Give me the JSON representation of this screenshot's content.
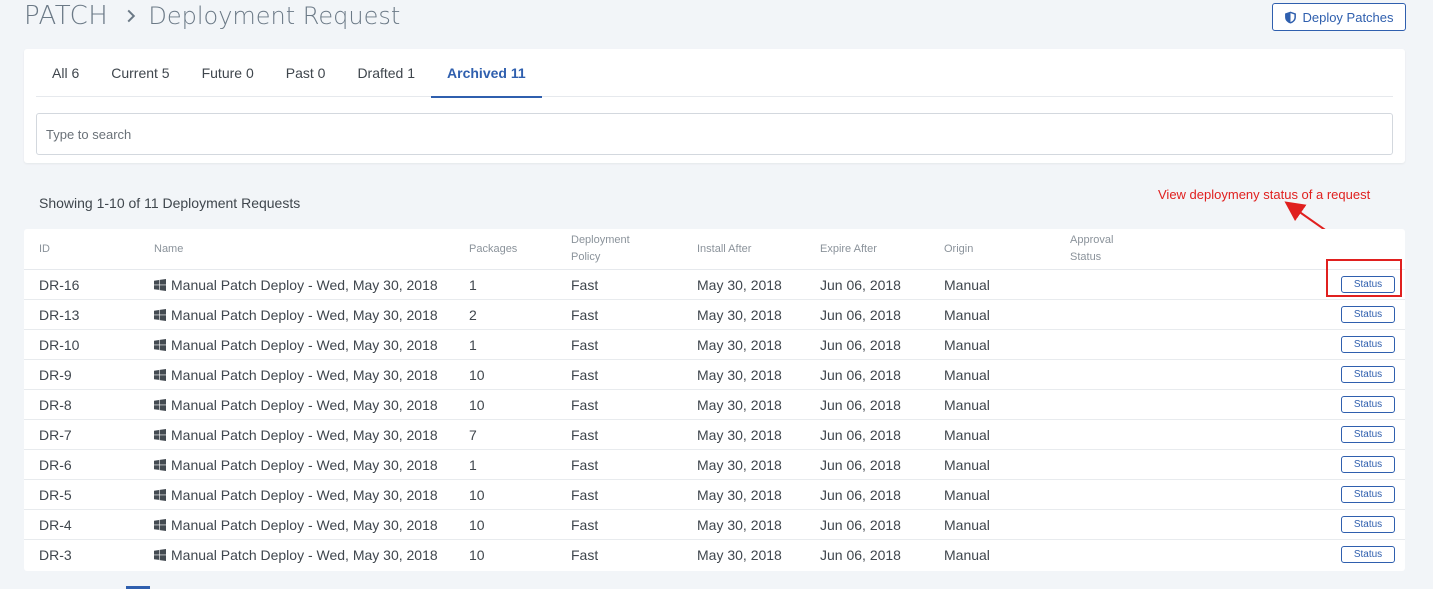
{
  "header": {
    "brand": "PATCH",
    "title": "Deployment Request",
    "deploy_button": "Deploy Patches"
  },
  "tabs": [
    {
      "label": "All 6",
      "active": false
    },
    {
      "label": "Current 5",
      "active": false
    },
    {
      "label": "Future 0",
      "active": false
    },
    {
      "label": "Past 0",
      "active": false
    },
    {
      "label": "Drafted 1",
      "active": false
    },
    {
      "label": "Archived 11",
      "active": true
    }
  ],
  "search": {
    "placeholder": "Type to search",
    "value": ""
  },
  "summary": "Showing 1-10 of 11 Deployment Requests",
  "annotation": "View deploymeny status of a request",
  "table": {
    "columns": {
      "id": "ID",
      "name": "Name",
      "packages": "Packages",
      "policy_1": "Deployment",
      "policy_2": "Policy",
      "install_after": "Install After",
      "expire_after": "Expire After",
      "origin": "Origin",
      "approval_1": "Approval",
      "approval_2": "Status"
    },
    "status_label": "Status",
    "rows": [
      {
        "id": "DR-16",
        "name": "Manual Patch Deploy - Wed, May 30, 2018",
        "packages": "1",
        "policy": "Fast",
        "install_after": "May 30, 2018",
        "expire_after": "Jun 06, 2018",
        "origin": "Manual",
        "approval": ""
      },
      {
        "id": "DR-13",
        "name": "Manual Patch Deploy - Wed, May 30, 2018",
        "packages": "2",
        "policy": "Fast",
        "install_after": "May 30, 2018",
        "expire_after": "Jun 06, 2018",
        "origin": "Manual",
        "approval": ""
      },
      {
        "id": "DR-10",
        "name": "Manual Patch Deploy - Wed, May 30, 2018",
        "packages": "1",
        "policy": "Fast",
        "install_after": "May 30, 2018",
        "expire_after": "Jun 06, 2018",
        "origin": "Manual",
        "approval": ""
      },
      {
        "id": "DR-9",
        "name": "Manual Patch Deploy - Wed, May 30, 2018",
        "packages": "10",
        "policy": "Fast",
        "install_after": "May 30, 2018",
        "expire_after": "Jun 06, 2018",
        "origin": "Manual",
        "approval": ""
      },
      {
        "id": "DR-8",
        "name": "Manual Patch Deploy - Wed, May 30, 2018",
        "packages": "10",
        "policy": "Fast",
        "install_after": "May 30, 2018",
        "expire_after": "Jun 06, 2018",
        "origin": "Manual",
        "approval": ""
      },
      {
        "id": "DR-7",
        "name": "Manual Patch Deploy - Wed, May 30, 2018",
        "packages": "7",
        "policy": "Fast",
        "install_after": "May 30, 2018",
        "expire_after": "Jun 06, 2018",
        "origin": "Manual",
        "approval": ""
      },
      {
        "id": "DR-6",
        "name": "Manual Patch Deploy - Wed, May 30, 2018",
        "packages": "1",
        "policy": "Fast",
        "install_after": "May 30, 2018",
        "expire_after": "Jun 06, 2018",
        "origin": "Manual",
        "approval": ""
      },
      {
        "id": "DR-5",
        "name": "Manual Patch Deploy - Wed, May 30, 2018",
        "packages": "10",
        "policy": "Fast",
        "install_after": "May 30, 2018",
        "expire_after": "Jun 06, 2018",
        "origin": "Manual",
        "approval": ""
      },
      {
        "id": "DR-4",
        "name": "Manual Patch Deploy - Wed, May 30, 2018",
        "packages": "10",
        "policy": "Fast",
        "install_after": "May 30, 2018",
        "expire_after": "Jun 06, 2018",
        "origin": "Manual",
        "approval": ""
      },
      {
        "id": "DR-3",
        "name": "Manual Patch Deploy - Wed, May 30, 2018",
        "packages": "10",
        "policy": "Fast",
        "install_after": "May 30, 2018",
        "expire_after": "Jun 06, 2018",
        "origin": "Manual",
        "approval": ""
      }
    ]
  },
  "colors": {
    "accent": "#2f5fae",
    "annotation": "#e0201f"
  },
  "icons": {
    "breadcrumb": "chevron-right-icon",
    "deploy": "shield-icon",
    "row": "windows-icon"
  }
}
